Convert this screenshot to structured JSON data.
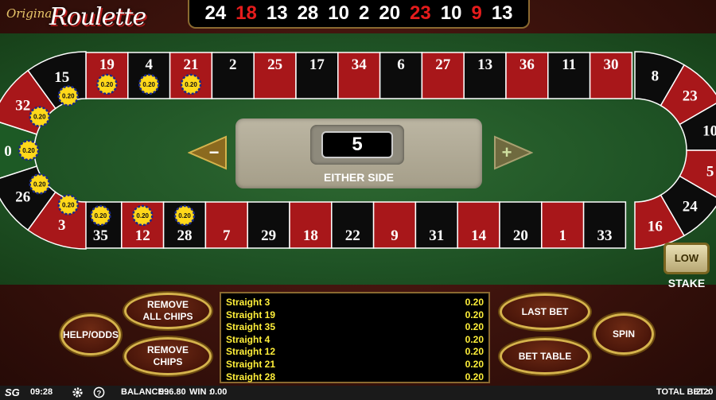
{
  "header": {
    "logo_top": "Original",
    "logo_main": "Roulette",
    "history": [
      {
        "n": "24",
        "c": "black"
      },
      {
        "n": "18",
        "c": "red"
      },
      {
        "n": "13",
        "c": "black"
      },
      {
        "n": "28",
        "c": "black"
      },
      {
        "n": "10",
        "c": "black"
      },
      {
        "n": "2",
        "c": "black"
      },
      {
        "n": "20",
        "c": "black"
      },
      {
        "n": "23",
        "c": "red"
      },
      {
        "n": "10",
        "c": "black"
      },
      {
        "n": "9",
        "c": "red"
      },
      {
        "n": "13",
        "c": "black"
      }
    ]
  },
  "racetrack": {
    "top_row": [
      {
        "n": "19",
        "c": "red"
      },
      {
        "n": "4",
        "c": "black"
      },
      {
        "n": "21",
        "c": "red"
      },
      {
        "n": "2",
        "c": "black"
      },
      {
        "n": "25",
        "c": "red"
      },
      {
        "n": "17",
        "c": "black"
      },
      {
        "n": "34",
        "c": "red"
      },
      {
        "n": "6",
        "c": "black"
      },
      {
        "n": "27",
        "c": "red"
      },
      {
        "n": "13",
        "c": "black"
      },
      {
        "n": "36",
        "c": "red"
      },
      {
        "n": "11",
        "c": "black"
      },
      {
        "n": "30",
        "c": "red"
      }
    ],
    "bottom_row": [
      {
        "n": "35",
        "c": "black"
      },
      {
        "n": "12",
        "c": "red"
      },
      {
        "n": "28",
        "c": "black"
      },
      {
        "n": "7",
        "c": "red"
      },
      {
        "n": "29",
        "c": "black"
      },
      {
        "n": "18",
        "c": "red"
      },
      {
        "n": "22",
        "c": "black"
      },
      {
        "n": "9",
        "c": "red"
      },
      {
        "n": "31",
        "c": "black"
      },
      {
        "n": "14",
        "c": "red"
      },
      {
        "n": "20",
        "c": "black"
      },
      {
        "n": "1",
        "c": "red"
      },
      {
        "n": "33",
        "c": "black"
      }
    ],
    "left_curve": [
      {
        "n": "15",
        "c": "black"
      },
      {
        "n": "32",
        "c": "red"
      },
      {
        "n": "0",
        "c": "green"
      },
      {
        "n": "26",
        "c": "black"
      },
      {
        "n": "3",
        "c": "red"
      }
    ],
    "right_curve": [
      {
        "n": "8",
        "c": "black"
      },
      {
        "n": "23",
        "c": "red"
      },
      {
        "n": "10",
        "c": "black"
      },
      {
        "n": "5",
        "c": "red"
      },
      {
        "n": "24",
        "c": "black"
      },
      {
        "n": "16",
        "c": "red"
      }
    ],
    "chip_value": "0.20",
    "chips_on": [
      "19",
      "4",
      "21",
      "15",
      "32",
      "0",
      "26",
      "3",
      "35",
      "12",
      "28"
    ]
  },
  "neighbours": {
    "value": "5",
    "caption": "EITHER SIDE",
    "minus": "−",
    "plus": "+"
  },
  "controls": {
    "low_label": "LOW",
    "stake_label": "STAKE",
    "help_label": "HELP/ODDS",
    "remove_all_label": "REMOVE ALL CHIPS",
    "remove_label": "REMOVE CHIPS",
    "last_bet_label": "LAST BET",
    "bet_table_label": "BET TABLE",
    "spin_label": "SPIN"
  },
  "bets": [
    {
      "name": "Straight 3",
      "amount": "0.20"
    },
    {
      "name": "Straight 19",
      "amount": "0.20"
    },
    {
      "name": "Straight 35",
      "amount": "0.20"
    },
    {
      "name": "Straight 4",
      "amount": "0.20"
    },
    {
      "name": "Straight 12",
      "amount": "0.20"
    },
    {
      "name": "Straight 21",
      "amount": "0.20"
    },
    {
      "name": "Straight 28",
      "amount": "0.20"
    }
  ],
  "status": {
    "brand": "SG",
    "time": "09:28",
    "balance_label": "BALANCE :",
    "balance": "996.80",
    "win_label": "WIN :",
    "win": "0.00",
    "total_bet_label": "TOTAL BET :",
    "total_bet": "2.20"
  },
  "colors": {
    "red": "#a8171a",
    "black": "#0c0c0c",
    "green": "#1d5a25",
    "gold": "#d5b34c",
    "chip": "#ffd81a"
  }
}
